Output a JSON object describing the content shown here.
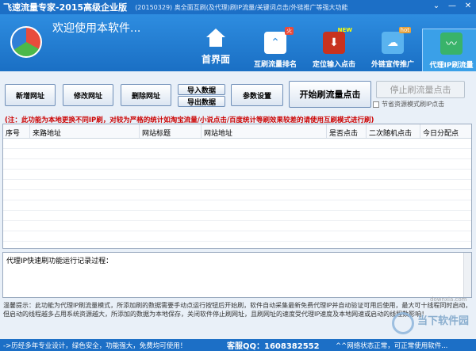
{
  "window": {
    "title": "飞速流量专家-2015高级企业版",
    "title_note": "(20150329) 奥全面互刷(及代理)刷IP流量/关键词点击/外链推广等强大功能",
    "buttons": [
      "⌄",
      "—",
      "✕"
    ]
  },
  "header": {
    "welcome": "欢迎使用本软件...",
    "home_label": "首界面",
    "nav": [
      {
        "label": "互刷流量排名",
        "badge": "火",
        "color": "#2f8fe0",
        "glyph": "⌃"
      },
      {
        "label": "定位输入点击",
        "badge": "NEW",
        "color": "#c8321f",
        "glyph": "⬇"
      },
      {
        "label": "外链宣传推广",
        "badge": "hot",
        "color": "#5ab3ef",
        "glyph": "☁"
      },
      {
        "label": "代理IP刷流量",
        "badge": "",
        "color": "#39b36a",
        "glyph": "〰"
      }
    ]
  },
  "toolbar": {
    "add": "新增网址",
    "edit": "修改网址",
    "delete": "删除网址",
    "import": "导入数据",
    "export": "导出数据",
    "settings": "参数设置",
    "start": "开始刷流量点击",
    "stop": "停止刷流量点击",
    "save_mode": "节省资源模式刷IP点击"
  },
  "notice": "(注：此功能为本地更换不同IP刷，对较为严格的统计如淘宝流量/小说点击/百度统计等刷效果较差的请使用互刷模式进行刷)",
  "grid": {
    "columns": [
      "序号",
      "来路地址",
      "网站标题",
      "网站地址",
      "是否点击",
      "二次随机点击",
      "今日分配点"
    ]
  },
  "log": {
    "title": "代理IP快速刷功能运行记录过程："
  },
  "tip": "温馨提示：此功能为代理IP刷流量模式，所添加刷的数据需要手动点运行按钮后开始刷，软件自动采集最新免费代理IP并自动验证可用后使用，最大可十线程同时启动，但启动的线程越多占用系统资源越大，所添加的数据为本地保存，关闭软件停止刷网址，且刷网址的速度受代理IP速度及本地网速或启动的线程数影响！",
  "status": {
    "left": "->历经多年专业设计，绿色安全，功能强大，免费均可使用！",
    "qq": "客服QQ：1608382552",
    "right": "^^网络状态正常，可正常使用软件..."
  },
  "watermark": {
    "text": "当下软件园",
    "url": "downxia.com"
  }
}
